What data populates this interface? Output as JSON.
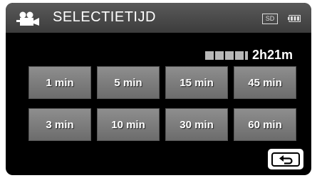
{
  "header": {
    "title": "SELECTIETIJD",
    "mode_icon": "video-camera-icon",
    "media_label": "SD",
    "battery_icon": "battery-icon"
  },
  "remaining": {
    "time": "2h21m"
  },
  "options": [
    {
      "label": "1 min"
    },
    {
      "label": "5 min"
    },
    {
      "label": "15 min"
    },
    {
      "label": "45 min"
    },
    {
      "label": "3 min"
    },
    {
      "label": "10 min"
    },
    {
      "label": "30 min"
    },
    {
      "label": "60 min"
    }
  ],
  "back_button": {
    "icon": "return-arrow-icon"
  }
}
